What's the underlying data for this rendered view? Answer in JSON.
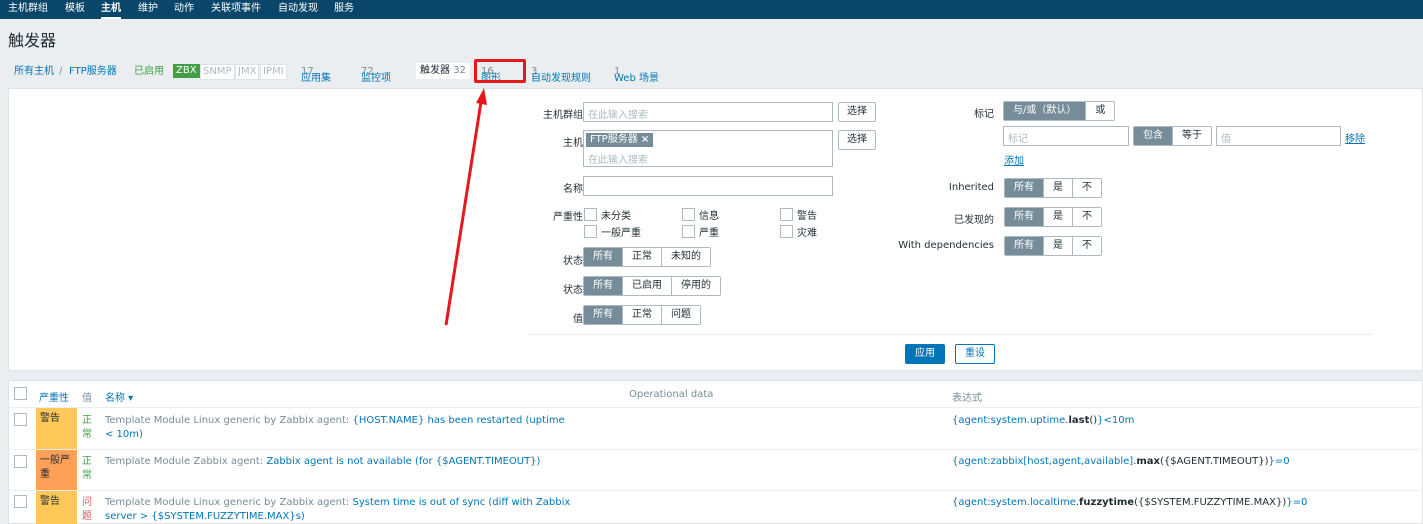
{
  "topnav": [
    "主机群组",
    "模板",
    "主机",
    "维护",
    "动作",
    "关联项事件",
    "自动发现",
    "服务"
  ],
  "page_title": "触发器",
  "breadcrumb": {
    "all_hosts": "所有主机",
    "separator": "/",
    "host": "FTP服务器",
    "enabled": "已启用"
  },
  "availability": [
    "ZBX",
    "SNMP",
    "JMX",
    "IPMI"
  ],
  "tabs": [
    {
      "label": "应用集",
      "count": "17"
    },
    {
      "label": "监控项",
      "count": "72"
    },
    {
      "label": "触发器",
      "count": "32"
    },
    {
      "label": "图形",
      "count": "16"
    },
    {
      "label": "自动发现规则",
      "count": "3"
    },
    {
      "label": "Web 场景",
      "count": "1"
    }
  ],
  "filter": {
    "host_group_label": "主机群组",
    "host_group_placeholder": "在此输入搜索",
    "select_btn": "选择",
    "host_label": "主机",
    "host_chip": "FTP服务器",
    "host_chip_remove": "×",
    "host_placeholder": "在此输入搜索",
    "name_label": "名称",
    "severity_label": "严重性",
    "severities": [
      "未分类",
      "信息",
      "警告",
      "一般严重",
      "严重",
      "灾难"
    ],
    "state_label": "状态",
    "state_options": [
      "所有",
      "正常",
      "未知的"
    ],
    "status_label": "状态",
    "status_options": [
      "所有",
      "已启用",
      "停用的"
    ],
    "value_label": "值",
    "value_options": [
      "所有",
      "正常",
      "问题"
    ],
    "tags_label": "标记",
    "tags_operator": [
      "与/或（默认）",
      "或"
    ],
    "tag_placeholder": "标记",
    "tag_match": [
      "包含",
      "等于"
    ],
    "tag_value_placeholder": "值",
    "remove_link": "移除",
    "add_link": "添加",
    "inherited_label": "Inherited",
    "discovered_label": "已发现的",
    "dependencies_label": "With dependencies",
    "tri_options": [
      "所有",
      "是",
      "不"
    ],
    "apply_btn": "应用",
    "reset_btn": "重设"
  },
  "table": {
    "headers": {
      "severity": "严重性",
      "value": "值",
      "name": "名称 ▾",
      "opdata": "Operational data",
      "expression": "表达式"
    },
    "rows": [
      {
        "severity": "警告",
        "sev_color": "#ffc859",
        "status": "正常",
        "status_type": "ok",
        "template": "Template Module Linux generic by Zabbix agent",
        "colon": ":",
        "name": "{HOST.NAME} has been restarted (uptime < 10m)",
        "expr_open": "{",
        "expr_item": "agent:system.uptime",
        "expr_dot": ".",
        "expr_func": "last",
        "expr_args": "()",
        "expr_close": "}<10m"
      },
      {
        "severity": "一般严重",
        "sev_color": "#ffa059",
        "status": "正常",
        "status_type": "ok",
        "template": "Template Module Zabbix agent",
        "colon": ":",
        "name": "Zabbix agent is not available (for {$AGENT.TIMEOUT})",
        "expr_open": "{",
        "expr_item": "agent:zabbix[host,agent,available]",
        "expr_dot": ".",
        "expr_func": "max",
        "expr_args": "({$AGENT.TIMEOUT})",
        "expr_close": "}=0"
      },
      {
        "severity": "警告",
        "sev_color": "#ffc859",
        "status": "问题",
        "status_type": "problem",
        "template": "Template Module Linux generic by Zabbix agent",
        "colon": ":",
        "name": "System time is out of sync (diff with Zabbix server > {$SYSTEM.FUZZYTIME.MAX}s)",
        "expr_open": "{",
        "expr_item": "agent:system.localtime",
        "expr_dot": ".",
        "expr_func": "fuzzytime",
        "expr_args": "({$SYSTEM.FUZZYTIME.MAX})",
        "expr_close": "}=0"
      }
    ]
  }
}
